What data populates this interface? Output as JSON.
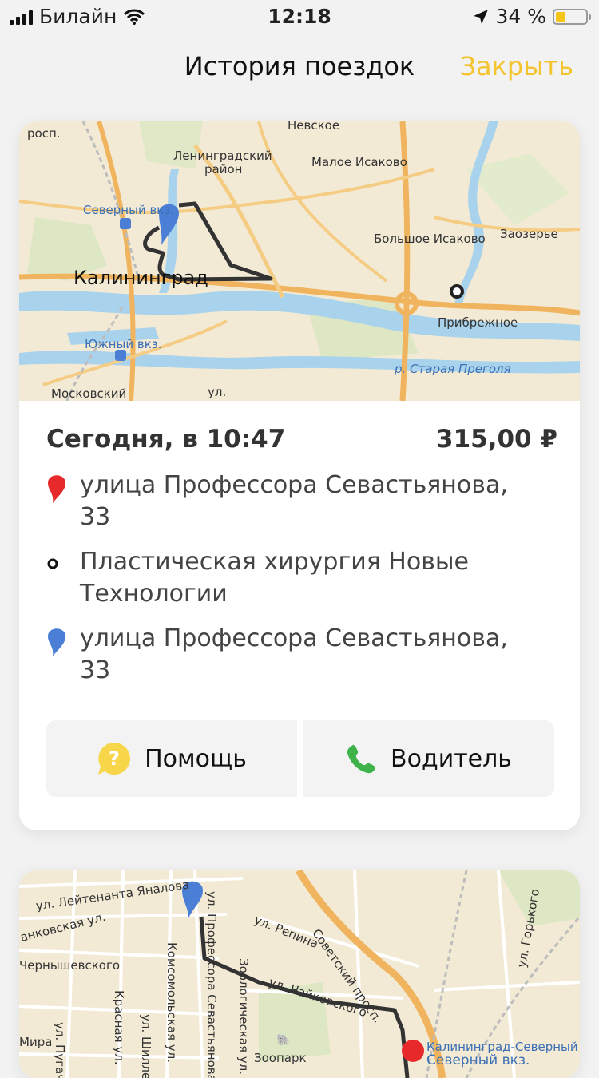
{
  "status_bar": {
    "carrier": "Билайн",
    "time": "12:18",
    "battery": "34 %",
    "battery_level": 0.34
  },
  "header": {
    "title": "История поездок",
    "close_label": "Закрыть"
  },
  "trips": [
    {
      "map_labels": {
        "nevskoe": "Невское",
        "leningradsky": "Ленинградский",
        "rayon": "район",
        "maloe_isakovo": "Малое Исаково",
        "severny_vkz": "Северный вкз.",
        "bolshoe_isakovo": "Большое Исаково",
        "zaozerye": "Заозерье",
        "kaliningrad": "Калининград",
        "pribrezhnoe": "Прибрежное",
        "yuzhny_vkz": "Южный вкз.",
        "staraya_pregolya": "р. Старая Преголя",
        "moskovsky": "Московский",
        "ul": "ул.",
        "prosp": "росп."
      },
      "date": "Сегодня, в 10:47",
      "price": "315,00 ₽",
      "stops": [
        {
          "type": "start",
          "text": "улица Профессора Севастьянова, 33"
        },
        {
          "type": "intermediate",
          "text": "Пластическая хирургия Новые Технологии"
        },
        {
          "type": "end",
          "text": "улица Профессора Севастьянова, 33"
        }
      ],
      "buttons": {
        "help": "Помощь",
        "driver": "Водитель"
      }
    },
    {
      "map_labels": {
        "leytenanta": "ул. Лейтенанта Яналова",
        "ankovskaya": "анковская ул.",
        "chernyshevskogo": "Чернышевского",
        "pugacheva": "ул. Пугачева",
        "krasnaya": "Красная ул.",
        "shillera": "ул. Шиллера",
        "komsomolskaya": "Комсомольская ул.",
        "sevastyanova": "ул. Профессора Севастьянова",
        "zoologicheskaya": "Зоологическая ул.",
        "repina": "ул. Репина",
        "chaikovskogo": "ул. Чайковского",
        "sovetsky": "Советский просп.",
        "gorkogo": "ул. Горького",
        "zoopark": "Зоопарк",
        "mira": "Мира",
        "kld_severny": "Калининград-Северный",
        "severny_vkz": "Северный вкз."
      }
    }
  ],
  "colors": {
    "accent": "#f4c430",
    "start_pin": "#e8292b",
    "end_pin": "#4b7fd6",
    "phone": "#3db34a",
    "help": "#f7d64a"
  }
}
